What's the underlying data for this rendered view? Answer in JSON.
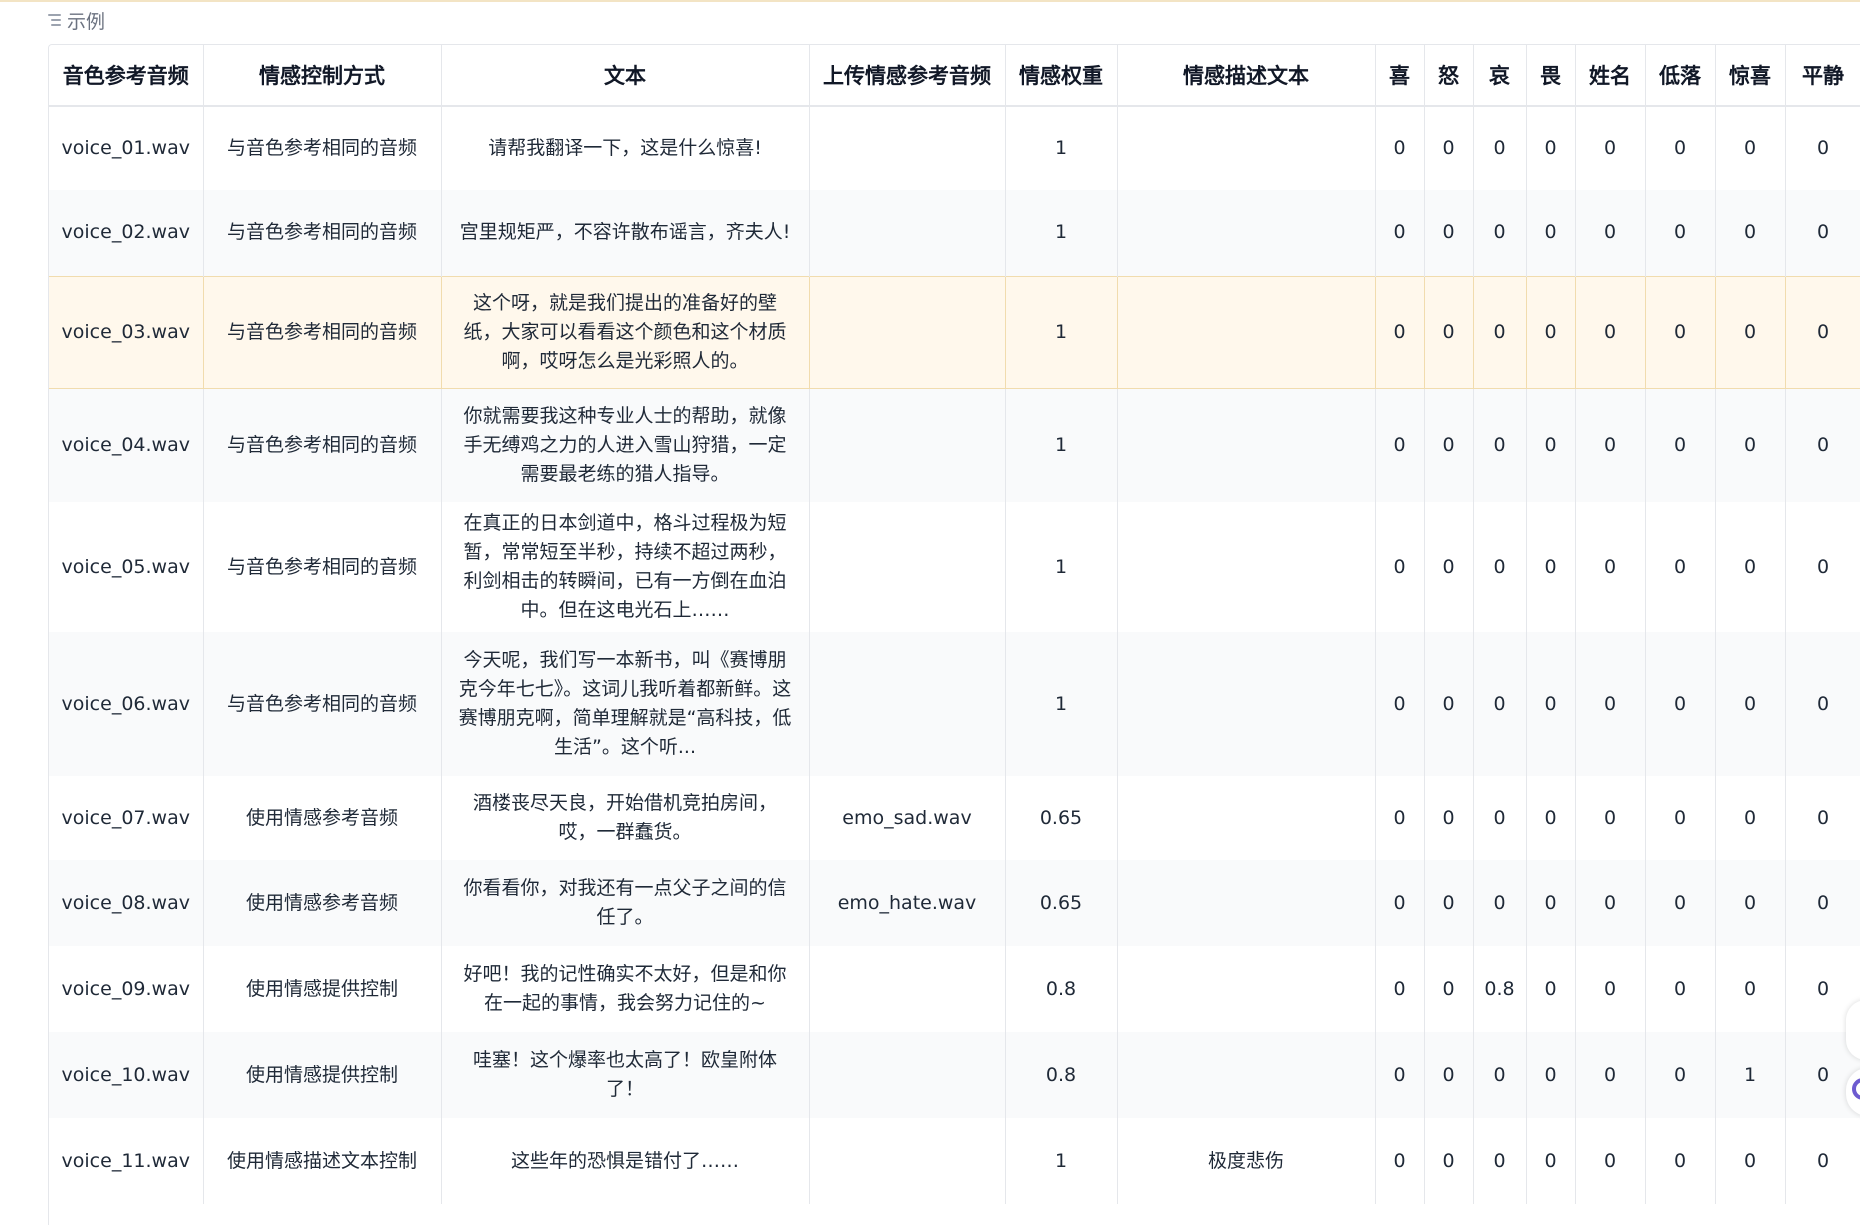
{
  "section_label": "示例",
  "columns": [
    "音色参考音频",
    "情感控制方式",
    "文本",
    "上传情感参考音频",
    "情感权重",
    "情感描述文本",
    "喜",
    "怒",
    "哀",
    "畏",
    "姓名",
    "低落",
    "惊喜",
    "平静"
  ],
  "rows": [
    [
      "voice_01.wav",
      "与音色参考相同的音频",
      "请帮我翻译一下，这是什么惊喜!",
      "",
      "1",
      "",
      "0",
      "0",
      "0",
      "0",
      "0",
      "0",
      "0",
      "0"
    ],
    [
      "voice_02.wav",
      "与音色参考相同的音频",
      "宫里规矩严，不容许散布谣言，齐夫人!",
      "",
      "1",
      "",
      "0",
      "0",
      "0",
      "0",
      "0",
      "0",
      "0",
      "0"
    ],
    [
      "voice_03.wav",
      "与音色参考相同的音频",
      "这个呀，就是我们提出的准备好的壁纸，大家可以看看这个颜色和这个材质啊，哎呀怎么是光彩照人的。",
      "",
      "1",
      "",
      "0",
      "0",
      "0",
      "0",
      "0",
      "0",
      "0",
      "0"
    ],
    [
      "voice_04.wav",
      "与音色参考相同的音频",
      "你就需要我这种专业人士的帮助，就像手无缚鸡之力的人进入雪山狩猎，一定需要最老练的猎人指导。",
      "",
      "1",
      "",
      "0",
      "0",
      "0",
      "0",
      "0",
      "0",
      "0",
      "0"
    ],
    [
      "voice_05.wav",
      "与音色参考相同的音频",
      "在真正的日本剑道中，格斗过程极为短暂，常常短至半秒，持续不超过两秒，利剑相击的转瞬间，已有一方倒在血泊中。但在这电光石上……",
      "",
      "1",
      "",
      "0",
      "0",
      "0",
      "0",
      "0",
      "0",
      "0",
      "0"
    ],
    [
      "voice_06.wav",
      "与音色参考相同的音频",
      "今天呢，我们写一本新书，叫《赛博朋克今年七七》。这词儿我听着都新鲜。这赛博朋克啊，简单理解就是“高科技，低生活”。这个听...",
      "",
      "1",
      "",
      "0",
      "0",
      "0",
      "0",
      "0",
      "0",
      "0",
      "0"
    ],
    [
      "voice_07.wav",
      "使用情感参考音频",
      "酒楼丧尽天良，开始借机竞拍房间，哎，一群蠢货。",
      "emo_sad.wav",
      "0.65",
      "",
      "0",
      "0",
      "0",
      "0",
      "0",
      "0",
      "0",
      "0"
    ],
    [
      "voice_08.wav",
      "使用情感参考音频",
      "你看看你，对我还有一点父子之间的信任了。",
      "emo_hate.wav",
      "0.65",
      "",
      "0",
      "0",
      "0",
      "0",
      "0",
      "0",
      "0",
      "0"
    ],
    [
      "voice_09.wav",
      "使用情感提供控制",
      "好吧！我的记性确实不太好，但是和你在一起的事情，我会努力记住的~",
      "",
      "0.8",
      "",
      "0",
      "0",
      "0.8",
      "0",
      "0",
      "0",
      "0",
      "0"
    ],
    [
      "voice_10.wav",
      "使用情感提供控制",
      "哇塞！这个爆率也太高了！欧皇附体了！",
      "",
      "0.8",
      "",
      "0",
      "0",
      "0",
      "0",
      "0",
      "0",
      "1",
      "0"
    ],
    [
      "voice_11.wav",
      "使用情感描述文本控制",
      "这些年的恐惧是错付了……",
      "",
      "1",
      "极度悲伤",
      "0",
      "0",
      "0",
      "0",
      "0",
      "0",
      "0",
      "0"
    ]
  ],
  "highlighted_row": 2
}
